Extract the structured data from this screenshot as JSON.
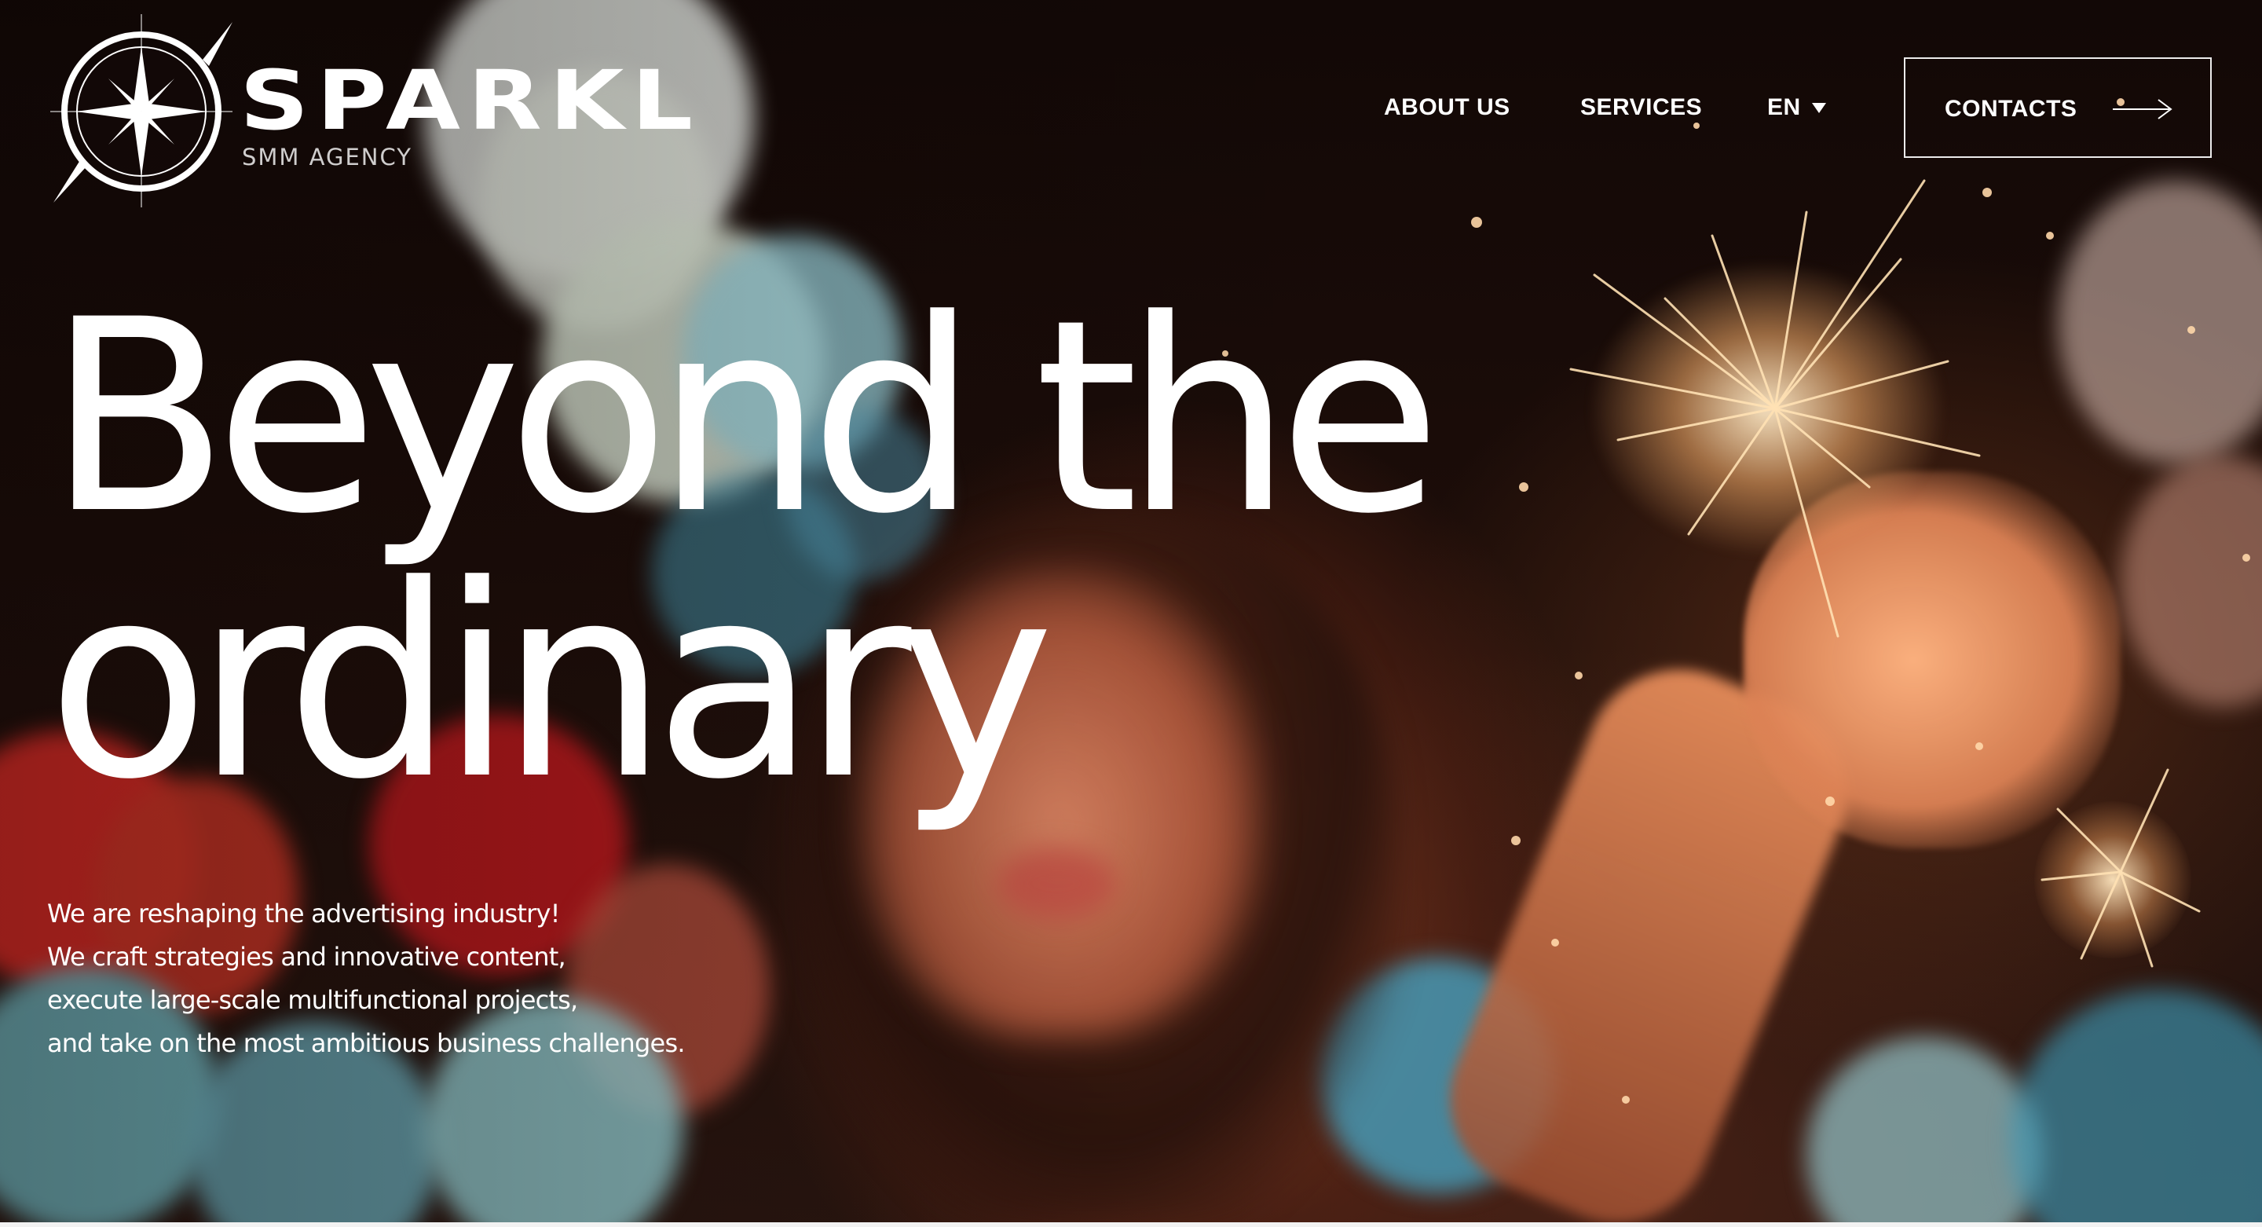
{
  "brand": {
    "name": "SPARKL",
    "tagline": "SMM AGENCY"
  },
  "nav": {
    "about": "ABOUT US",
    "services": "SERVICES",
    "language": "EN",
    "contacts": "CONTACTS"
  },
  "hero": {
    "headline_line1": "Beyond the",
    "headline_line2": "ordinary",
    "description": [
      "We are reshaping the advertising industry!",
      "We craft strategies and innovative content,",
      "execute large-scale multifunctional projects,",
      "and take on the most ambitious business challenges."
    ]
  },
  "icons": {
    "logo": "compass-star-icon",
    "language_dropdown": "caret-down-icon",
    "contacts_arrow": "arrow-right-icon"
  },
  "colors": {
    "text": "#ffffff",
    "background": "#140a08"
  }
}
